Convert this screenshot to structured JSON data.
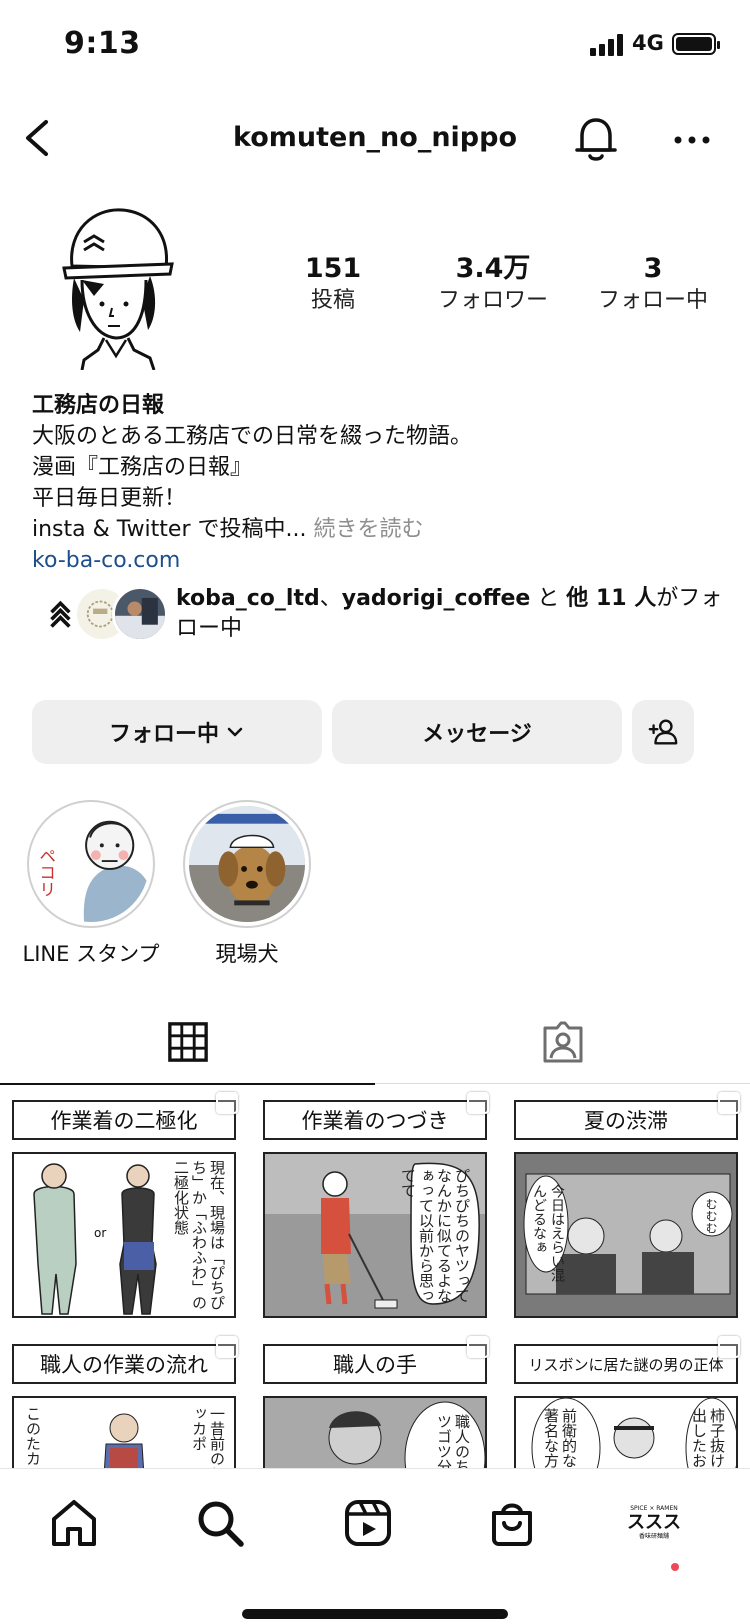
{
  "status_bar": {
    "time": "9:13",
    "network": "4G"
  },
  "header": {
    "username": "komuten_no_nippo"
  },
  "stats": [
    {
      "value": "151",
      "label": "投稿"
    },
    {
      "value": "3.4万",
      "label": "フォロワー"
    },
    {
      "value": "3",
      "label": "フォロー中"
    }
  ],
  "bio": {
    "name": "工務店の日報",
    "lines": [
      "大阪のとある工務店での日常を綴った物語。",
      "漫画『工務店の日報』",
      "平日毎日更新！"
    ],
    "last_line": "insta & Twitter で投稿中... ",
    "more": "続きを読む",
    "link": "ko-ba-co.com"
  },
  "followed_by": {
    "user1": "koba_co_ltd",
    "sep": "、",
    "user2": "yadorigi_coffee",
    "mid": " と ",
    "others": "他 11 人",
    "tail": "がフォロー中"
  },
  "actions": {
    "following": "フォロー中",
    "message": "メッセージ"
  },
  "highlights": [
    {
      "label": "LINE スタンプ",
      "stamp_text": "ペコリ"
    },
    {
      "label": "現場犬"
    }
  ],
  "posts": [
    {
      "caption": "作業着の二極化",
      "inner_text": "現在、現場は「ぴちぴち」か「ふわふわ」の二極化状態",
      "or": "or"
    },
    {
      "caption": "作業着のつづき",
      "inner_text": "ぴちぴちのヤツってなんかに似てるよなぁって以前から思ってて"
    },
    {
      "caption": "夏の渋滞",
      "inner_text": "今日はえらい混んどるなぁ",
      "inner_text2": "むむむ"
    },
    {
      "caption": "職人の作業の流れ",
      "inner_text": "このたカッコ",
      "inner_text2": "一昔前のといったニッカポ"
    },
    {
      "caption": "職人の手",
      "inner_text": "職人のちゅうゴツゴツ分厚く"
    },
    {
      "caption": "リスボンに居た謎の男の正体",
      "inner_text": "前衛的な久保田弘著名な方",
      "inner_text2": "柿子抜け謎の男は出したお"
    }
  ],
  "bottom_nav": {
    "profile_mini_text": "ススス",
    "profile_mini_top": "SPICE × RAMEN",
    "profile_mini_sub": "香味研麺舗"
  },
  "colors": {
    "link": "#1d4f8b",
    "button_bg": "#efefef",
    "notification_dot": "#ed4956",
    "muted": "#8e8e8e"
  }
}
